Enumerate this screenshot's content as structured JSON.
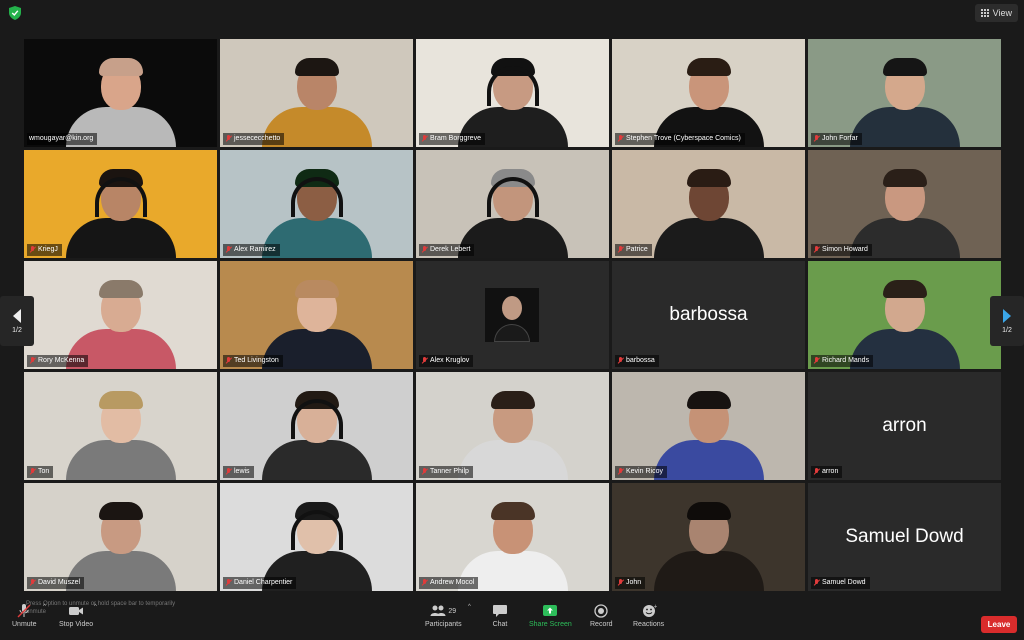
{
  "topbar": {
    "view_label": "View"
  },
  "participants": [
    {
      "name": "wmougayar@kin.org",
      "muted": false,
      "active": true,
      "bg": "#0b0b0b",
      "skin": "#d9a58a",
      "shirt": "#b9b9b9",
      "hair": "#c7a08a"
    },
    {
      "name": "jessececchetto",
      "muted": true,
      "bg": "#cfc8bc",
      "skin": "#b98568",
      "shirt": "#c58a2a",
      "hair": "#1c1612"
    },
    {
      "name": "Bram Borggreve",
      "muted": true,
      "bg": "#e8e4dc",
      "skin": "#c79a82",
      "shirt": "#1e1e1e",
      "hair": "#111111",
      "headset": true
    },
    {
      "name": "Stephen Trove (Cyberspace Comics)",
      "muted": true,
      "bg": "#d8d2c6",
      "skin": "#c9957a",
      "shirt": "#121212",
      "hair": "#2a1d14"
    },
    {
      "name": "John Forfar",
      "muted": true,
      "bg": "#8a9a86",
      "skin": "#d4a88c",
      "shirt": "#24303c",
      "hair": "#151515"
    },
    {
      "name": "KriegJ",
      "muted": true,
      "bg": "#e9a92b",
      "skin": "#b88566",
      "shirt": "#151515",
      "hair": "#1b1410",
      "headset": true
    },
    {
      "name": "Alex Ramirez",
      "muted": true,
      "bg": "#b7c3c6",
      "skin": "#8c5e44",
      "shirt": "#2e6b72",
      "hair": "#0f2a14",
      "headset": true
    },
    {
      "name": "Derek Lebert",
      "muted": true,
      "bg": "#c8c2b8",
      "skin": "#c2957c",
      "shirt": "#1b1b1b",
      "hair": "#8a8a8a",
      "headset": true
    },
    {
      "name": "Patrice",
      "muted": true,
      "bg": "#c9b9a6",
      "skin": "#6e4634",
      "shirt": "#1b1b1b",
      "hair": "#2a1c14"
    },
    {
      "name": "Simon Howard",
      "muted": true,
      "bg": "#6f6254",
      "skin": "#c99880",
      "shirt": "#2c2c2c",
      "hair": "#2a1f18"
    },
    {
      "name": "Rory McKenna",
      "muted": true,
      "bg": "#e0dad2",
      "skin": "#d8ab92",
      "shirt": "#c85866",
      "hair": "#8a7a6a"
    },
    {
      "name": "Ted Livingston",
      "muted": true,
      "bg": "#b88a4e",
      "skin": "#deb49a",
      "shirt": "#1a1f2c",
      "hair": "#b98a60"
    },
    {
      "name": "Alex Kruglov",
      "muted": true,
      "bg": "#2a2a2a",
      "thumb": true
    },
    {
      "name": "barbossa",
      "muted": true,
      "bg": "#2a2a2a",
      "big": "barbossa"
    },
    {
      "name": "Richard Mands",
      "muted": true,
      "bg": "#6a9c4c",
      "skin": "#d2a88e",
      "shirt": "#243040",
      "hair": "#2a2018"
    },
    {
      "name": "Ton",
      "muted": true,
      "bg": "#d8d4cc",
      "skin": "#e2bca4",
      "shirt": "#7a7a7a",
      "hair": "#b89a62"
    },
    {
      "name": "lewis",
      "muted": true,
      "bg": "#cfcfcf",
      "skin": "#d8b098",
      "shirt": "#2a2a2a",
      "hair": "#221a14",
      "headset": true
    },
    {
      "name": "Tanner Philp",
      "muted": true,
      "bg": "#d4d2cc",
      "skin": "#c89a80",
      "shirt": "#d8d8d8",
      "hair": "#2a1f18"
    },
    {
      "name": "Kevin Ricoy",
      "muted": true,
      "bg": "#bdb7ae",
      "skin": "#c59276",
      "shirt": "#3a4aa0",
      "hair": "#171210"
    },
    {
      "name": "arron",
      "muted": true,
      "bg": "#2a2a2a",
      "big": "arron"
    },
    {
      "name": "David Muszel",
      "muted": true,
      "bg": "#d6d2ca",
      "skin": "#c89a82",
      "shirt": "#7a7a7a",
      "hair": "#1b1512"
    },
    {
      "name": "Daniel Charpentier",
      "muted": true,
      "bg": "#dcdcdc",
      "skin": "#e0c0aa",
      "shirt": "#202020",
      "hair": "#1a1a1a",
      "headset": true
    },
    {
      "name": "Andrew Mocol",
      "muted": true,
      "bg": "#d8d6d0",
      "skin": "#c89276",
      "shirt": "#eeeeee",
      "hair": "#4a3426"
    },
    {
      "name": "John",
      "muted": true,
      "bg": "#3d352c",
      "skin": "#a98470",
      "shirt": "#1f1a16",
      "hair": "#0f0c0a"
    },
    {
      "name": "Samuel Dowd",
      "muted": true,
      "bg": "#2a2a2a",
      "big": "Samuel Dowd"
    }
  ],
  "paging": {
    "left": "1/2",
    "right": "1/2"
  },
  "toolbar": {
    "unmute": "Unmute",
    "stop_video": "Stop Video",
    "participants": "Participants",
    "participants_count": "29",
    "chat": "Chat",
    "share_screen": "Share Screen",
    "record": "Record",
    "reactions": "Reactions",
    "leave": "Leave",
    "hint": "Press Option to unmute or hold space bar to temporarily unmute"
  },
  "colors": {
    "share_green": "#2dbd5a",
    "leave_red": "#d92c2c",
    "active_outline": "#d8e69a",
    "muted_red": "#e03b3b"
  }
}
